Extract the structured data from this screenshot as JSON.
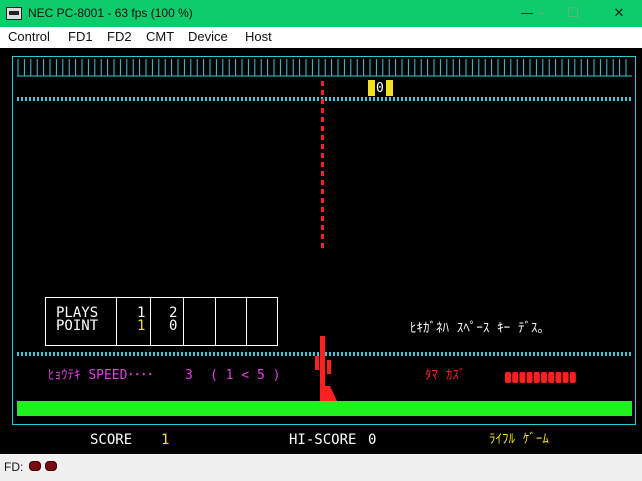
{
  "window": {
    "title": "NEC PC-8001 - 63 fps (100 %)",
    "minimize_icon": "minimize-icon",
    "maximize_icon": "maximize-icon",
    "close_icon": "close-icon"
  },
  "menu": [
    "Control",
    "FD1",
    "FD2",
    "CMT",
    "Device",
    "Host"
  ],
  "game": {
    "target_number": "0",
    "scoreboard": {
      "rows": [
        {
          "label": "PLAYS",
          "values": [
            "1",
            "2",
            "",
            "",
            ""
          ]
        },
        {
          "label": "POINT",
          "values": [
            "1",
            "0",
            "",
            "",
            ""
          ]
        }
      ]
    },
    "instruction": "ﾋｷｶﾞﾈﾊ ｽﾍﾟｰｽ ｷｰ ﾃﾞｽ｡",
    "speed_label": "ﾋｮｳﾃｷ SPEED････",
    "speed_value": "3",
    "speed_range": "( 1 < 5 )",
    "ammo_label": "ﾀﾏ ｶｽﾞ",
    "ammo_count": 10,
    "bottom": {
      "score_label": "SCORE",
      "score_value": "1",
      "hiscore_label": "HI-SCORE",
      "hiscore_value": "0",
      "game_name": "ﾗｲﾌﾙ ｹﾞｰﾑ"
    },
    "colors": {
      "cyan": "#3cc8d8",
      "red": "#ff2020",
      "magenta": "#e040e0",
      "yellow": "#f0e020",
      "green": "#20f020",
      "white": "#ffffff"
    }
  },
  "status": {
    "fd_label": "FD:"
  }
}
